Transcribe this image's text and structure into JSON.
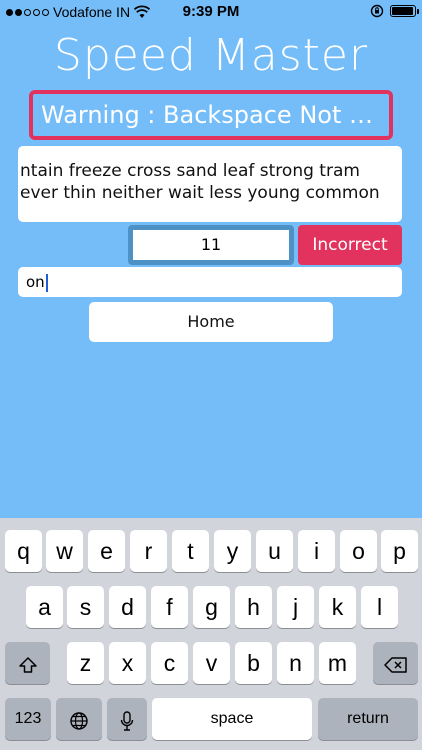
{
  "status_bar": {
    "carrier": "Vodafone IN",
    "time": "9:39 PM",
    "signal_bars": 2,
    "battery_level": 0.95
  },
  "app": {
    "title": "Speed Master",
    "warning": "Warning : Backspace Not All...",
    "words": [
      "ntain freeze cross sand leaf strong tram",
      "ever thin neither wait less young common"
    ],
    "counter": "11",
    "result_label": "Incorrect",
    "input_value": "on",
    "home_label": "Home"
  },
  "keyboard": {
    "row1": [
      "q",
      "w",
      "e",
      "r",
      "t",
      "y",
      "u",
      "i",
      "o",
      "p"
    ],
    "row2": [
      "a",
      "s",
      "d",
      "f",
      "g",
      "h",
      "j",
      "k",
      "l"
    ],
    "row3": [
      "z",
      "x",
      "c",
      "v",
      "b",
      "n",
      "m"
    ],
    "numbers_label": "123",
    "space_label": "space",
    "return_label": "return"
  },
  "colors": {
    "background": "#74bdf9",
    "accent": "#e2335e",
    "counter_border": "#4e92c5"
  }
}
